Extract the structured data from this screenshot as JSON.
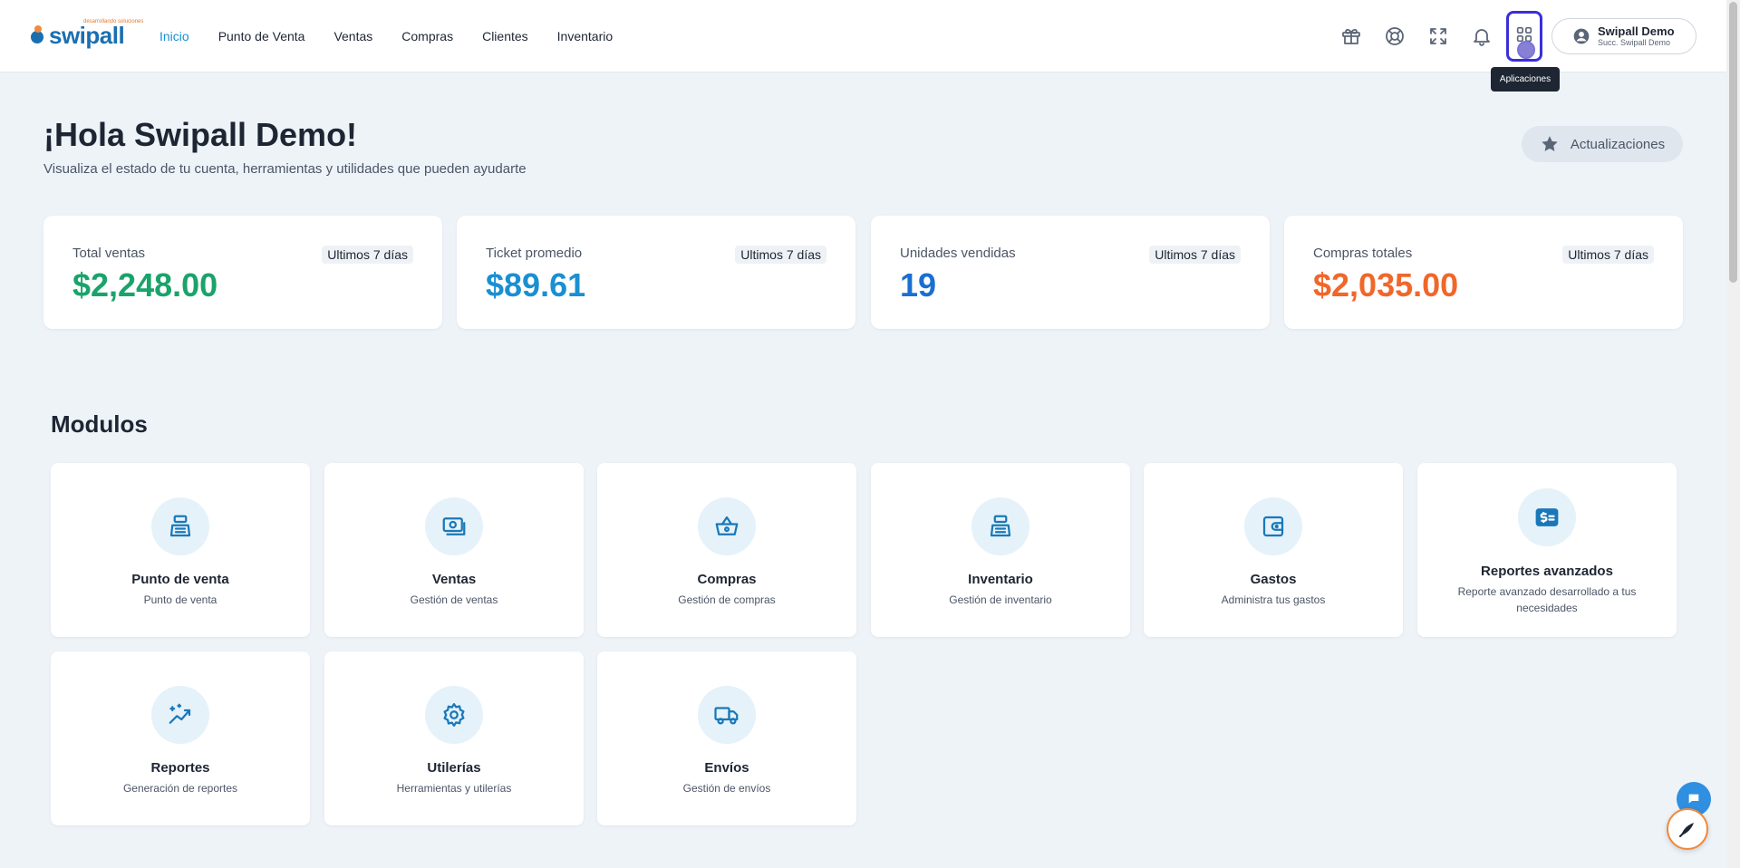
{
  "brand": {
    "logo_text": "swipall",
    "logo_sub": "desarrollando soluciones"
  },
  "nav": {
    "items": [
      {
        "label": "Inicio",
        "active": true
      },
      {
        "label": "Punto de Venta",
        "active": false
      },
      {
        "label": "Ventas",
        "active": false
      },
      {
        "label": "Compras",
        "active": false
      },
      {
        "label": "Clientes",
        "active": false
      },
      {
        "label": "Inventario",
        "active": false
      }
    ]
  },
  "toolbar": {
    "icons": [
      "gift-icon",
      "help-lifebuoy-icon",
      "fullscreen-icon",
      "bell-icon",
      "apps-grid-icon"
    ],
    "apps_tooltip": "Aplicaciones"
  },
  "user": {
    "name": "Swipall Demo",
    "branch": "Succ. Swipall Demo"
  },
  "header": {
    "greeting": "¡Hola Swipall Demo!",
    "subtitle": "Visualiza el estado de tu cuenta, herramientas y utilidades que pueden ayudarte",
    "updates_label": "Actualizaciones"
  },
  "stats": [
    {
      "label": "Total ventas",
      "badge": "Ultimos 7 días",
      "value": "$2,248.00",
      "color": "#1aa36a"
    },
    {
      "label": "Ticket promedio",
      "badge": "Ultimos 7 días",
      "value": "$89.61",
      "color": "#1a8fd1"
    },
    {
      "label": "Unidades vendidas",
      "badge": "Ultimos 7 días",
      "value": "19",
      "color": "#1a6fd1"
    },
    {
      "label": "Compras totales",
      "badge": "Ultimos 7 días",
      "value": "$2,035.00",
      "color": "#f0672a"
    }
  ],
  "modules": {
    "title": "Modulos",
    "items": [
      {
        "name": "Punto de venta",
        "desc": "Punto de venta",
        "icon": "cash-register-icon"
      },
      {
        "name": "Ventas",
        "desc": "Gestión de ventas",
        "icon": "money-icon"
      },
      {
        "name": "Compras",
        "desc": "Gestión de compras",
        "icon": "basket-icon"
      },
      {
        "name": "Inventario",
        "desc": "Gestión de inventario",
        "icon": "cash-register-icon"
      },
      {
        "name": "Gastos",
        "desc": "Administra tus gastos",
        "icon": "wallet-icon"
      },
      {
        "name": "Reportes avanzados",
        "desc": "Reporte avanzado desarrollado a tus necesidades",
        "icon": "dollar-report-icon"
      },
      {
        "name": "Reportes",
        "desc": "Generación de reportes",
        "icon": "chart-sparkle-icon"
      },
      {
        "name": "Utilerías",
        "desc": "Herramientas y utilerías",
        "icon": "gear-icon"
      },
      {
        "name": "Envíos",
        "desc": "Gestión de envíos",
        "icon": "truck-icon"
      }
    ]
  },
  "accent_color": "#1a8fd1"
}
